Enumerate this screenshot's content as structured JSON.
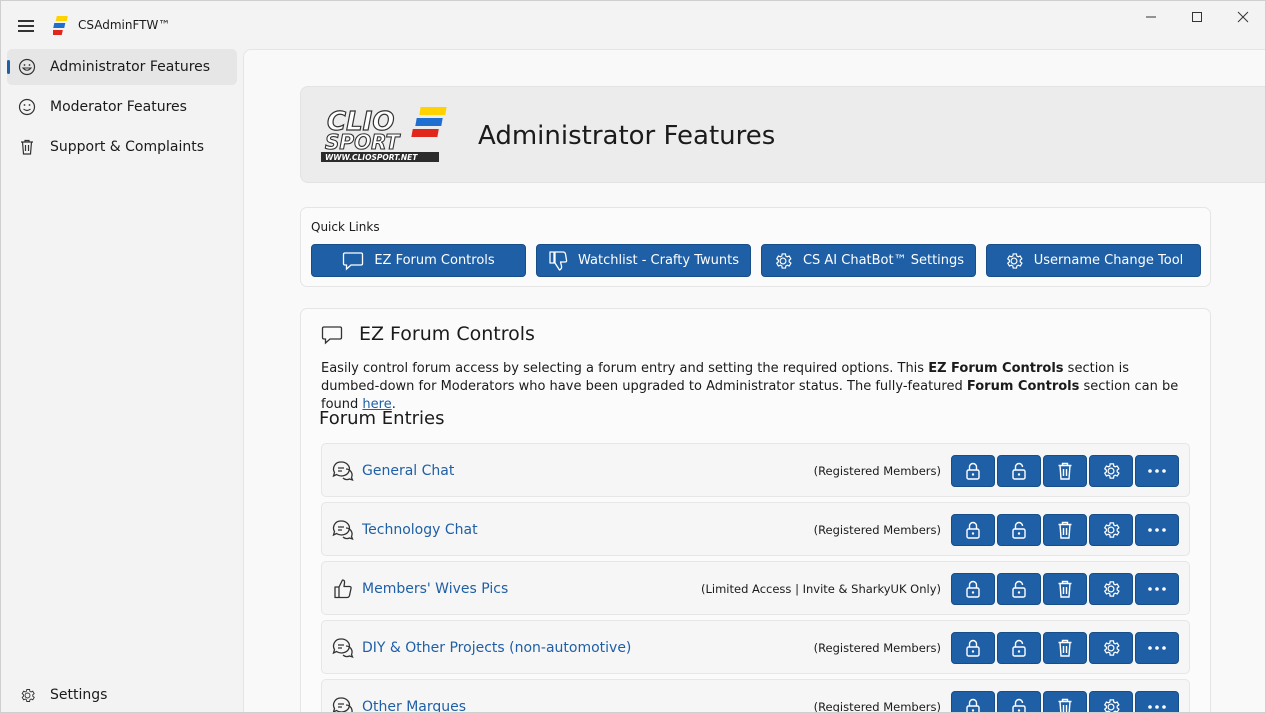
{
  "window": {
    "title": "CSAdminFTW™"
  },
  "colors": {
    "accent": "#1f5fa5",
    "logo_red": "#e1261c",
    "logo_yellow": "#ffd200",
    "logo_blue": "#1f6fd1"
  },
  "sidebar": {
    "items": [
      {
        "label": "Administrator Features",
        "icon": "smiley-icon",
        "active": true
      },
      {
        "label": "Moderator Features",
        "icon": "smiley-icon",
        "active": false
      },
      {
        "label": "Support & Complaints",
        "icon": "trash-icon",
        "active": false
      }
    ],
    "settings_label": "Settings"
  },
  "hero": {
    "title": "Administrator Features",
    "logo": {
      "line1": "CLIO",
      "line2": "SPORT",
      "url": "WWW.CLIOSPORT.NET"
    }
  },
  "quick_links": {
    "label": "Quick Links",
    "buttons": [
      {
        "label": "EZ Forum Controls",
        "icon": "chat-bubble-icon"
      },
      {
        "label": "Watchlist - Crafty Twunts",
        "icon": "thumbs-down-icon"
      },
      {
        "label": "CS AI ChatBot™ Settings",
        "icon": "gear-icon"
      },
      {
        "label": "Username Change Tool",
        "icon": "gear-icon"
      }
    ]
  },
  "ez_forum": {
    "title": "EZ Forum Controls",
    "desc_part1": "Easily control forum access by selecting a forum entry and setting the required options. This ",
    "desc_bold1": "EZ Forum Controls",
    "desc_part2": " section is dumbed-down for Moderators who have been upgraded to Administrator status. The fully-featured ",
    "desc_bold2": "Forum Controls",
    "desc_part3": " section can be found ",
    "desc_link": "here",
    "desc_end": ".",
    "entries_title": "Forum Entries",
    "entries": [
      {
        "name": "General Chat",
        "access": "(Registered Members)",
        "icon": "chat-bubbles-icon"
      },
      {
        "name": "Technology Chat",
        "access": "(Registered Members)",
        "icon": "chat-bubbles-icon"
      },
      {
        "name": "Members' Wives Pics",
        "access": "(Limited Access | Invite & SharkyUK Only)",
        "icon": "thumbs-up-icon"
      },
      {
        "name": "DIY & Other Projects (non-automotive)",
        "access": "(Registered Members)",
        "icon": "chat-bubbles-icon"
      },
      {
        "name": "Other Marques",
        "access": "(Registered Members)",
        "icon": "chat-bubbles-icon"
      }
    ]
  }
}
